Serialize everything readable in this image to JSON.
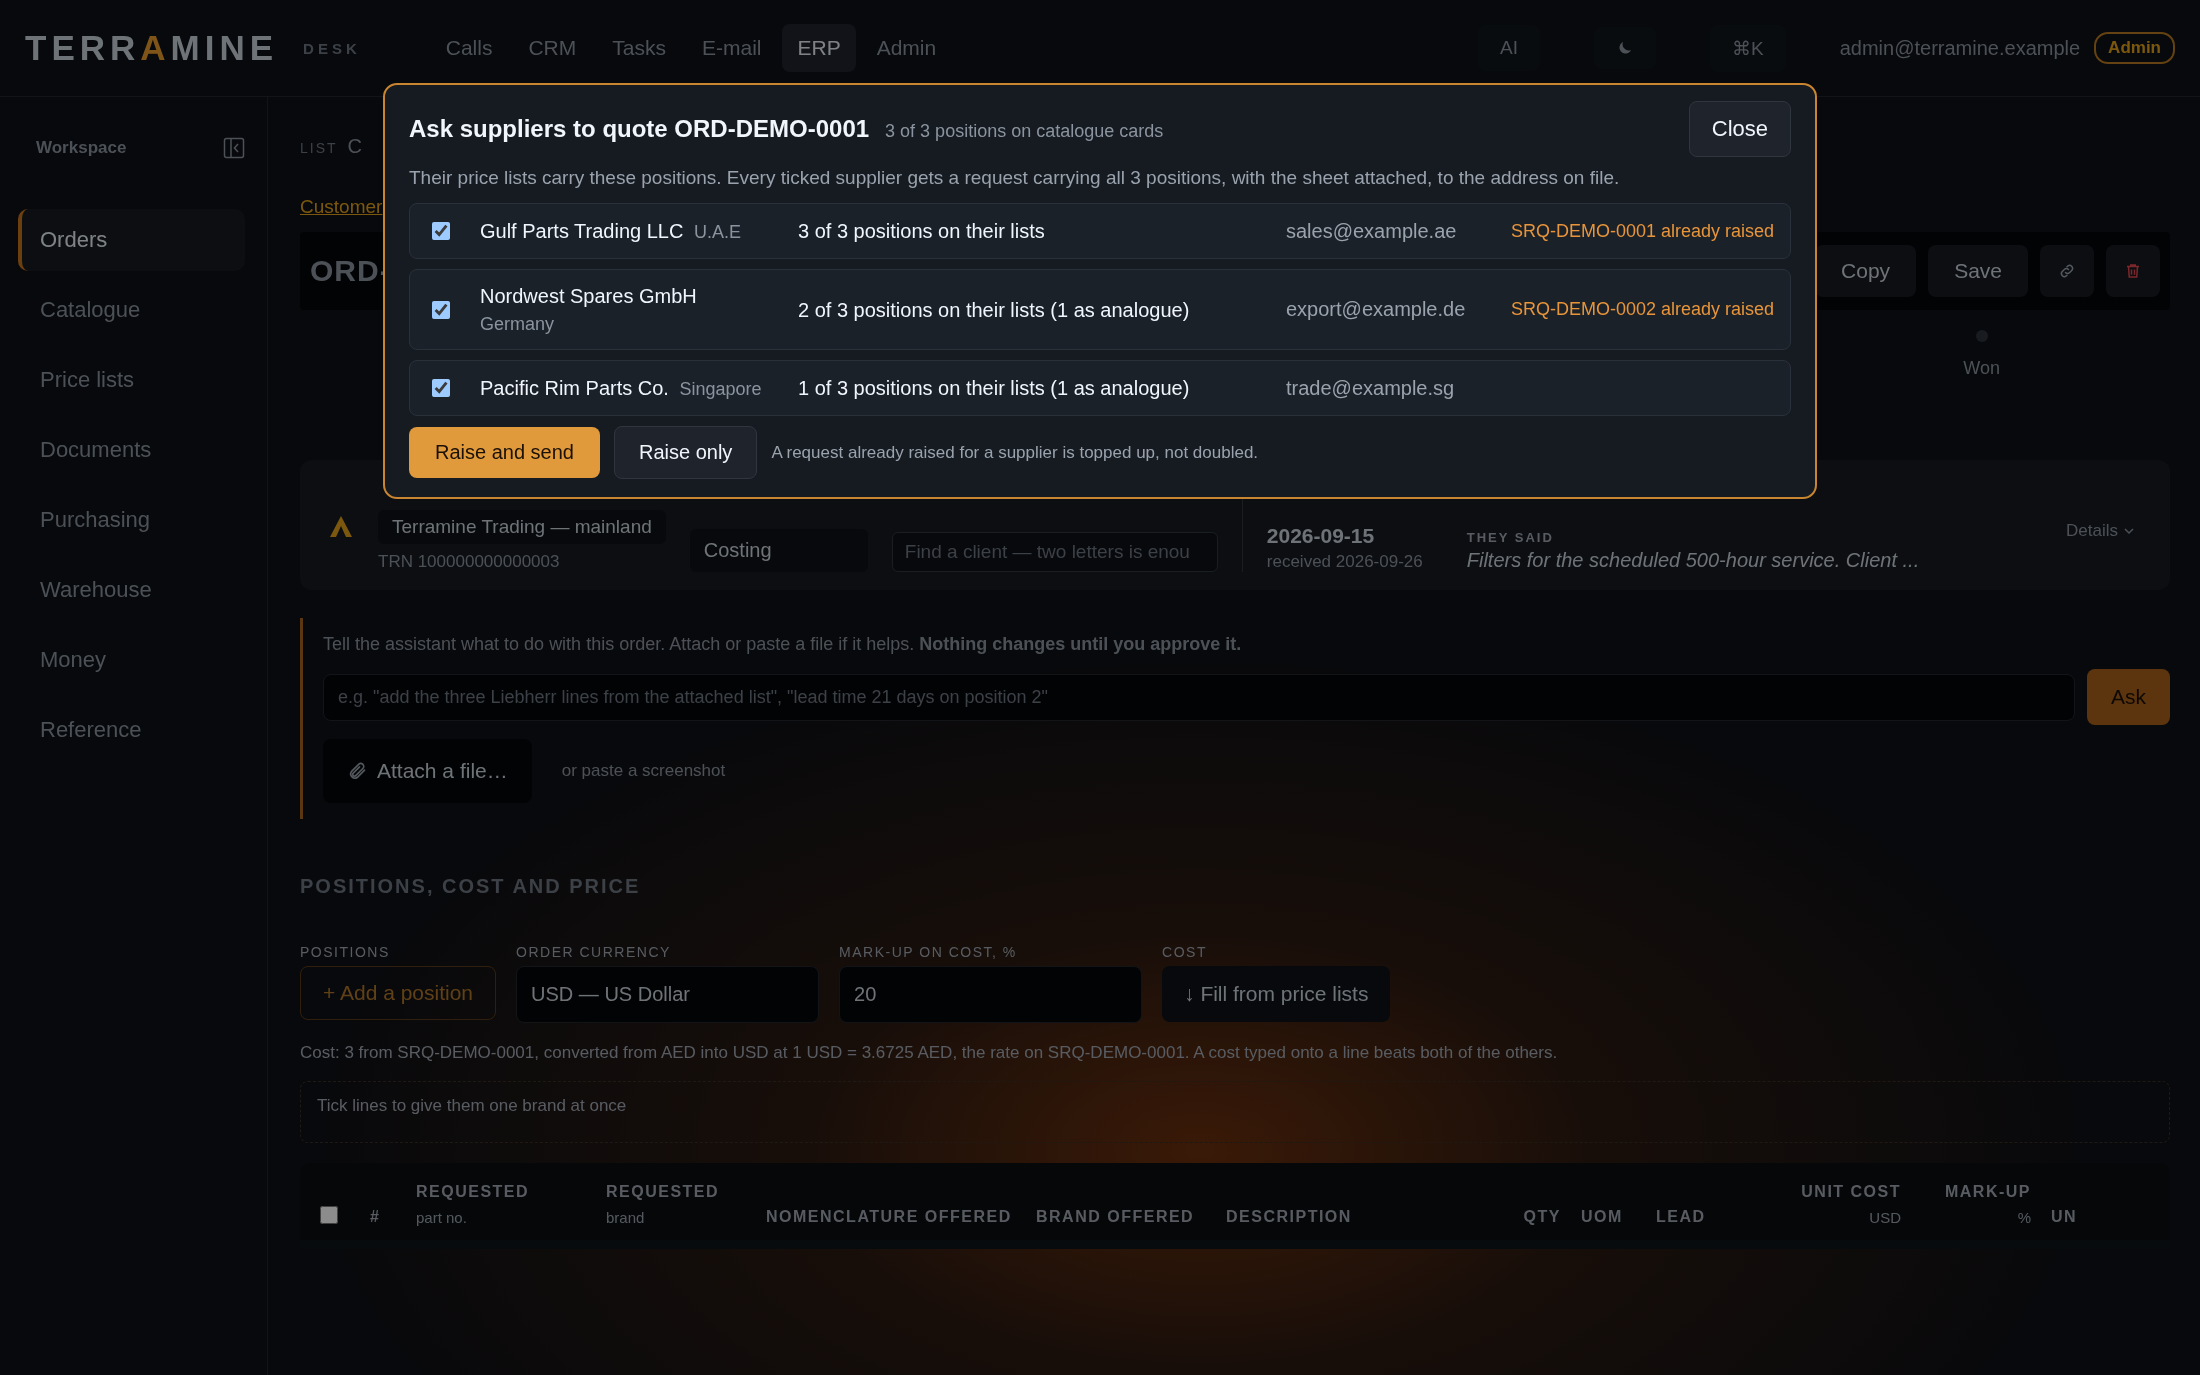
{
  "topbar": {
    "logo": {
      "before": "TERR",
      "accent": "A",
      "after": "MINE"
    },
    "product": "DESK",
    "nav": [
      {
        "label": "Calls",
        "selected": false
      },
      {
        "label": "CRM",
        "selected": false
      },
      {
        "label": "Tasks",
        "selected": false
      },
      {
        "label": "E-mail",
        "selected": false
      },
      {
        "label": "ERP",
        "selected": true
      },
      {
        "label": "Admin",
        "selected": false
      }
    ],
    "ai_button": "AI",
    "shortcut": "⌘K",
    "user": "admin@terramine.example",
    "role_badge": "Admin"
  },
  "sidebar": {
    "title": "Workspace",
    "items": [
      {
        "label": "Orders",
        "selected": true
      },
      {
        "label": "Catalogue",
        "selected": false
      },
      {
        "label": "Price lists",
        "selected": false
      },
      {
        "label": "Documents",
        "selected": false
      },
      {
        "label": "Purchasing",
        "selected": false
      },
      {
        "label": "Warehouse",
        "selected": false
      },
      {
        "label": "Money",
        "selected": false
      },
      {
        "label": "Reference",
        "selected": false
      }
    ]
  },
  "page": {
    "breadcrumb": {
      "kicker": "LIST",
      "title": "C"
    },
    "customer_link": "Customer",
    "order": {
      "number": "ORD-",
      "actions": [
        "Copy",
        "Save"
      ]
    },
    "stage": {
      "label": "Won"
    },
    "client_card": {
      "client": "Terramine Trading — mainland",
      "trn": "TRN 100000000000003",
      "status": "Costing",
      "client_search": {
        "placeholder": "Find a client — two letters is enou"
      },
      "date": "2026-09-15",
      "received": "received 2026-09-26",
      "quote_label": "THEY SAID",
      "quote": "Filters for the scheduled 500-hour service. Client ...",
      "details": "Details"
    },
    "assistant": {
      "intro": "Tell the assistant what to do with this order. Attach or paste a file if it helps. **Nothing changes until you approve it.**",
      "prompt": {
        "placeholder": "e.g. \"add the three Liebherr lines from the attached list\", \"lead time 21 days on position 2\""
      },
      "ask": "Ask",
      "attach": "Attach a file…",
      "paste_hint": "or paste a screenshot"
    },
    "positions": {
      "heading": "POSITIONS, COST AND PRICE",
      "add_label": "POSITIONS",
      "add_button": "+ Add a position",
      "currency_label": "ORDER CURRENCY",
      "currency": "USD — US Dollar",
      "markup_label": "MARK-UP ON COST, %",
      "markup": "20",
      "cost_label": "COST",
      "fill_button": "↓ Fill from price lists",
      "cost_note": "Cost: 3 from SRQ-DEMO-0001, converted from AED into USD at 1 USD = 3.6725 AED, the rate on SRQ-DEMO-0001. A cost typed onto a line beats both of the others.",
      "brand_hint": "Tick lines to give them one brand at once",
      "table": {
        "select_all": false,
        "columns": [
          {
            "label": "#"
          },
          {
            "label": "REQUESTED",
            "sub": "part no."
          },
          {
            "label": "REQUESTED",
            "sub": "brand"
          },
          {
            "label": "NOMENCLATURE OFFERED"
          },
          {
            "label": "BRAND OFFERED"
          },
          {
            "label": "DESCRIPTION"
          },
          {
            "label": "QTY"
          },
          {
            "label": "UOM"
          },
          {
            "label": "LEAD"
          },
          {
            "label": "UNIT COST",
            "sub": "USD"
          },
          {
            "label": "MARK-UP",
            "sub": "%"
          },
          {
            "label": "UN"
          }
        ]
      }
    }
  },
  "dialog": {
    "title": "Ask suppliers to quote ORD-DEMO-0001",
    "subtitle": "3 of 3 positions on catalogue cards",
    "close": "Close",
    "description": "Their price lists carry these positions. Every ticked supplier gets a request carrying all 3 positions, with the sheet attached, to the address on file.",
    "suppliers": [
      {
        "checked": true,
        "name": "Gulf Parts Trading LLC",
        "country": "U.A.E",
        "coverage": "3 of 3 positions on their lists",
        "email": "sales@example.ae",
        "note": "SRQ-DEMO-0001 already raised"
      },
      {
        "checked": true,
        "name": "Nordwest Spares GmbH",
        "country": "Germany",
        "coverage": "2 of 3 positions on their lists (1 as analogue)",
        "email": "export@example.de",
        "note": "SRQ-DEMO-0002 already raised"
      },
      {
        "checked": true,
        "name": "Pacific Rim Parts Co.",
        "country": "Singapore",
        "coverage": "1 of 3 positions on their lists (1 as analogue)",
        "email": "trade@example.sg"
      }
    ],
    "primary": "Raise and send",
    "secondary": "Raise only",
    "footnote": "A request already raised for a supplier is topped up, not doubled."
  }
}
